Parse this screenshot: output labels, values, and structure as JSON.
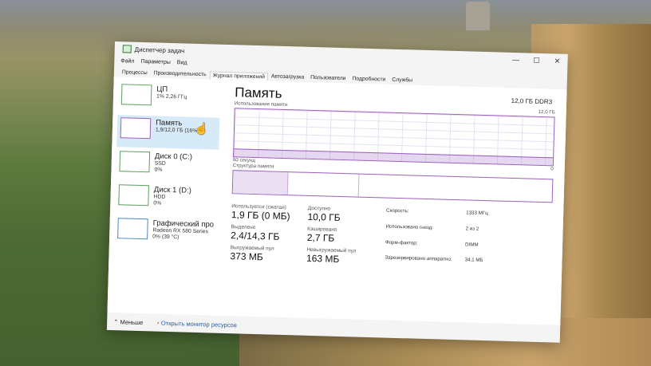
{
  "window": {
    "title": "Диспетчер задач"
  },
  "controls": {
    "minimize": "—",
    "maximize": "☐",
    "close": "✕"
  },
  "menu": [
    "Файл",
    "Параметры",
    "Вид"
  ],
  "tabs": [
    "Процессы",
    "Производительность",
    "Журнал приложений",
    "Автозагрузка",
    "Пользователи",
    "Подробности",
    "Службы"
  ],
  "sidebar": [
    {
      "title": "ЦП",
      "sub1": "1% 2,26 ГГц",
      "sub2": ""
    },
    {
      "title": "Память",
      "sub1": "1,9/12,0 ГБ (16%)",
      "sub2": ""
    },
    {
      "title": "Диск 0 (C:)",
      "sub1": "SSD",
      "sub2": "0%"
    },
    {
      "title": "Диск 1 (D:)",
      "sub1": "HDD",
      "sub2": "0%"
    },
    {
      "title": "Графический про",
      "sub1": "Radeon RX 580 Series",
      "sub2": "0% (39 °C)"
    }
  ],
  "main": {
    "title": "Память",
    "spec": "12,0 ГБ DDR3",
    "graph_label": "Использование памяти",
    "graph_max": "12,0 ГБ",
    "time_label": "60 секунд",
    "time_zero": "0",
    "struct_label": "Структура памяти"
  },
  "stats": {
    "in_use_label": "Используется (сжатая)",
    "in_use": "1,9 ГБ (0 МБ)",
    "available_label": "Доступно",
    "available": "10,0 ГБ",
    "committed_label": "Выделено",
    "committed": "2,4/14,3 ГБ",
    "cached_label": "Кэшировано",
    "cached": "2,7 ГБ",
    "paged_label": "Выгружаемый пул",
    "paged": "373 МБ",
    "nonpaged_label": "Невыгружаемый пул",
    "nonpaged": "163 МБ"
  },
  "props": {
    "speed_label": "Скорость:",
    "speed": "1333 МГц",
    "slots_label": "Использовано гнезд:",
    "slots": "2 из 2",
    "form_label": "Форм-фактор:",
    "form": "DIMM",
    "reserved_label": "Зарезервировано аппаратно:",
    "reserved": "34,1 МБ"
  },
  "footer": {
    "less": "Меньше",
    "monitor": "Открыть монитор ресурсов"
  }
}
